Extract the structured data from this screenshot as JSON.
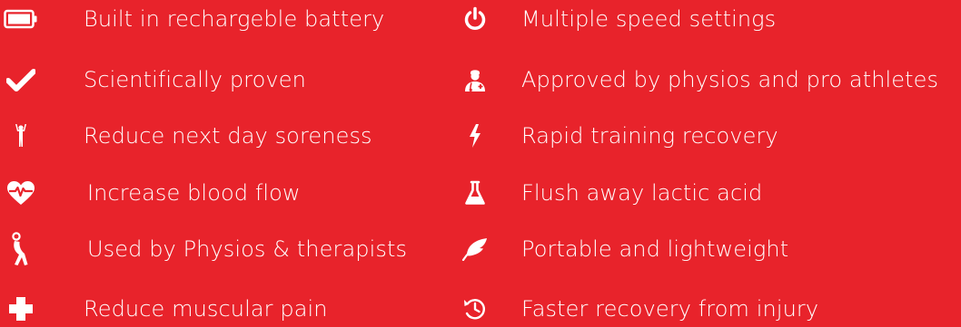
{
  "features": {
    "left": [
      {
        "icon": "battery-icon",
        "label": "Built in rechargeble battery"
      },
      {
        "icon": "checkmark-icon",
        "label": "Scientifically proven"
      },
      {
        "icon": "person-raised-arms-icon",
        "label": "Reduce next day soreness"
      },
      {
        "icon": "heartbeat-icon",
        "label": "Increase blood flow"
      },
      {
        "icon": "stretching-person-icon",
        "label": "Used by Physios & therapists"
      },
      {
        "icon": "medical-cross-icon",
        "label": "Reduce muscular pain"
      }
    ],
    "right": [
      {
        "icon": "power-icon",
        "label": "Multiple speed settings"
      },
      {
        "icon": "doctor-icon",
        "label": "Approved by physios and pro athletes"
      },
      {
        "icon": "lightning-icon",
        "label": "Rapid training recovery"
      },
      {
        "icon": "flask-icon",
        "label": "Flush away lactic acid"
      },
      {
        "icon": "feather-icon",
        "label": "Portable and lightweight"
      },
      {
        "icon": "history-icon",
        "label": "Faster recovery from injury"
      }
    ]
  },
  "colors": {
    "background": "#e8232b",
    "foreground": "#ffffff"
  }
}
